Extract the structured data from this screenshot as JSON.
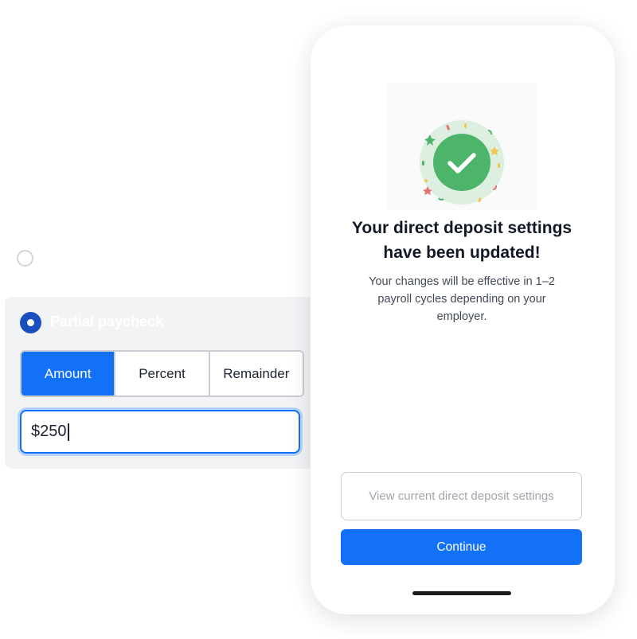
{
  "option_panel": {
    "option_label": "Partial paycheck",
    "segments": [
      {
        "label": "Amount",
        "active": true
      },
      {
        "label": "Percent",
        "active": false
      },
      {
        "label": "Remainder",
        "active": false
      }
    ],
    "amount_value": "$250"
  },
  "confirmation": {
    "headline_line1": "Your direct deposit settings",
    "headline_line2": "have been updated!",
    "body_line1": "Your changes will be effective in 1–2",
    "body_line2": "payroll cycles depending on your",
    "body_line3": "employer.",
    "secondary_button": "View current direct deposit settings",
    "primary_button": "Continue"
  },
  "colors": {
    "accent": "#1271F6",
    "success": "#4CB56A",
    "radio_selected": "#1A4FBF"
  },
  "icons": {
    "success": "check-icon"
  }
}
